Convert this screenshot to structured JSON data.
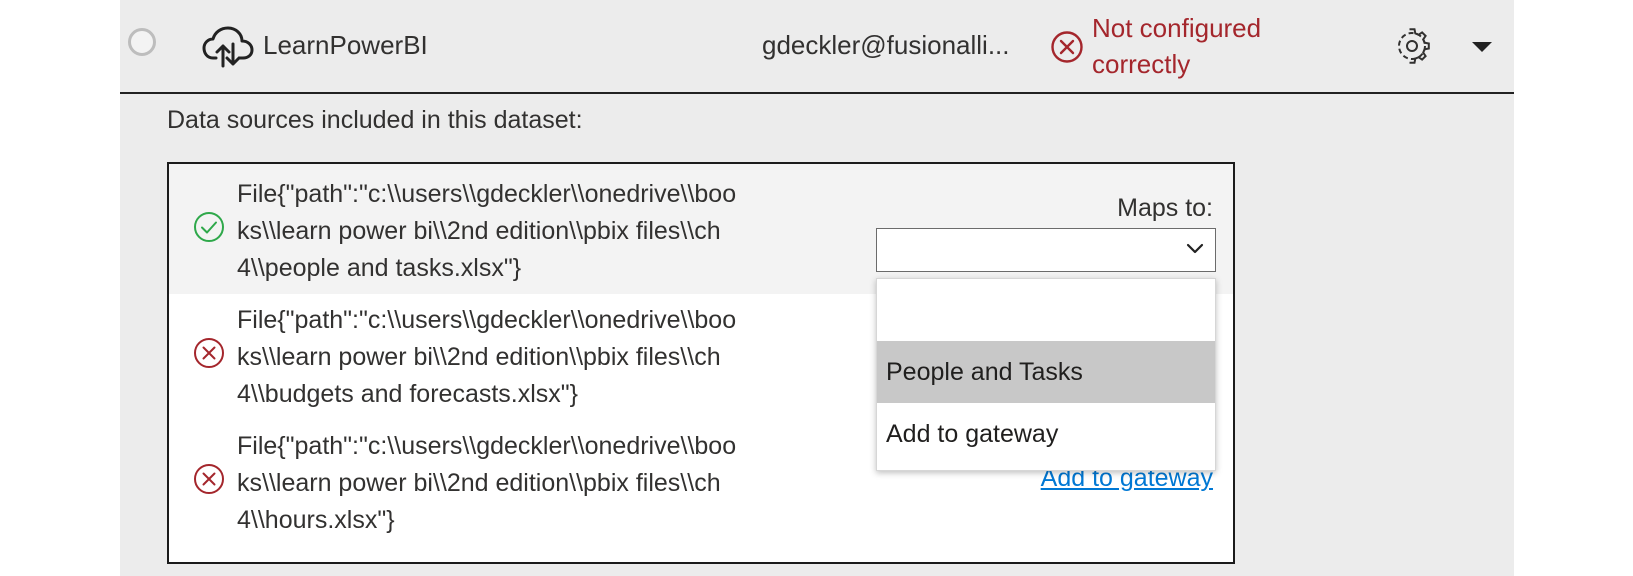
{
  "dataset": {
    "name": "LearnPowerBI",
    "owner": "gdeckler@fusionalli...",
    "status_line1": "Not configured",
    "status_line2": "correctly"
  },
  "sources_label": "Data sources included in this dataset:",
  "sources": [
    {
      "status": "ok",
      "path": "File{\"path\":\"c:\\\\users\\\\gdeckler\\\\onedrive\\\\boo\nks\\\\learn power bi\\\\2nd edition\\\\pbix files\\\\ch\n4\\\\people and tasks.xlsx\"}"
    },
    {
      "status": "error",
      "path": "File{\"path\":\"c:\\\\users\\\\gdeckler\\\\onedrive\\\\boo\nks\\\\learn power bi\\\\2nd edition\\\\pbix files\\\\ch\n4\\\\budgets and forecasts.xlsx\"}"
    },
    {
      "status": "error",
      "path": "File{\"path\":\"c:\\\\users\\\\gdeckler\\\\onedrive\\\\boo\nks\\\\learn power bi\\\\2nd edition\\\\pbix files\\\\ch\n4\\\\hours.xlsx\"}"
    }
  ],
  "maps_to_label": "Maps to:",
  "maps_select_value": "",
  "dropdown_options": [
    "",
    "People and Tasks",
    "Add to gateway"
  ],
  "add_to_gateway_link": "Add to gateway",
  "colors": {
    "error": "#a4262c",
    "success": "#2ea84a",
    "link": "#0078d4",
    "panel_bg": "#ececec",
    "highlight": "#c8c8c8"
  },
  "icons": [
    "radio-icon",
    "cloud-upload-icon",
    "error-circle-icon",
    "gear-icon",
    "caret-down-icon",
    "check-circle-icon",
    "chevron-down-icon"
  ]
}
